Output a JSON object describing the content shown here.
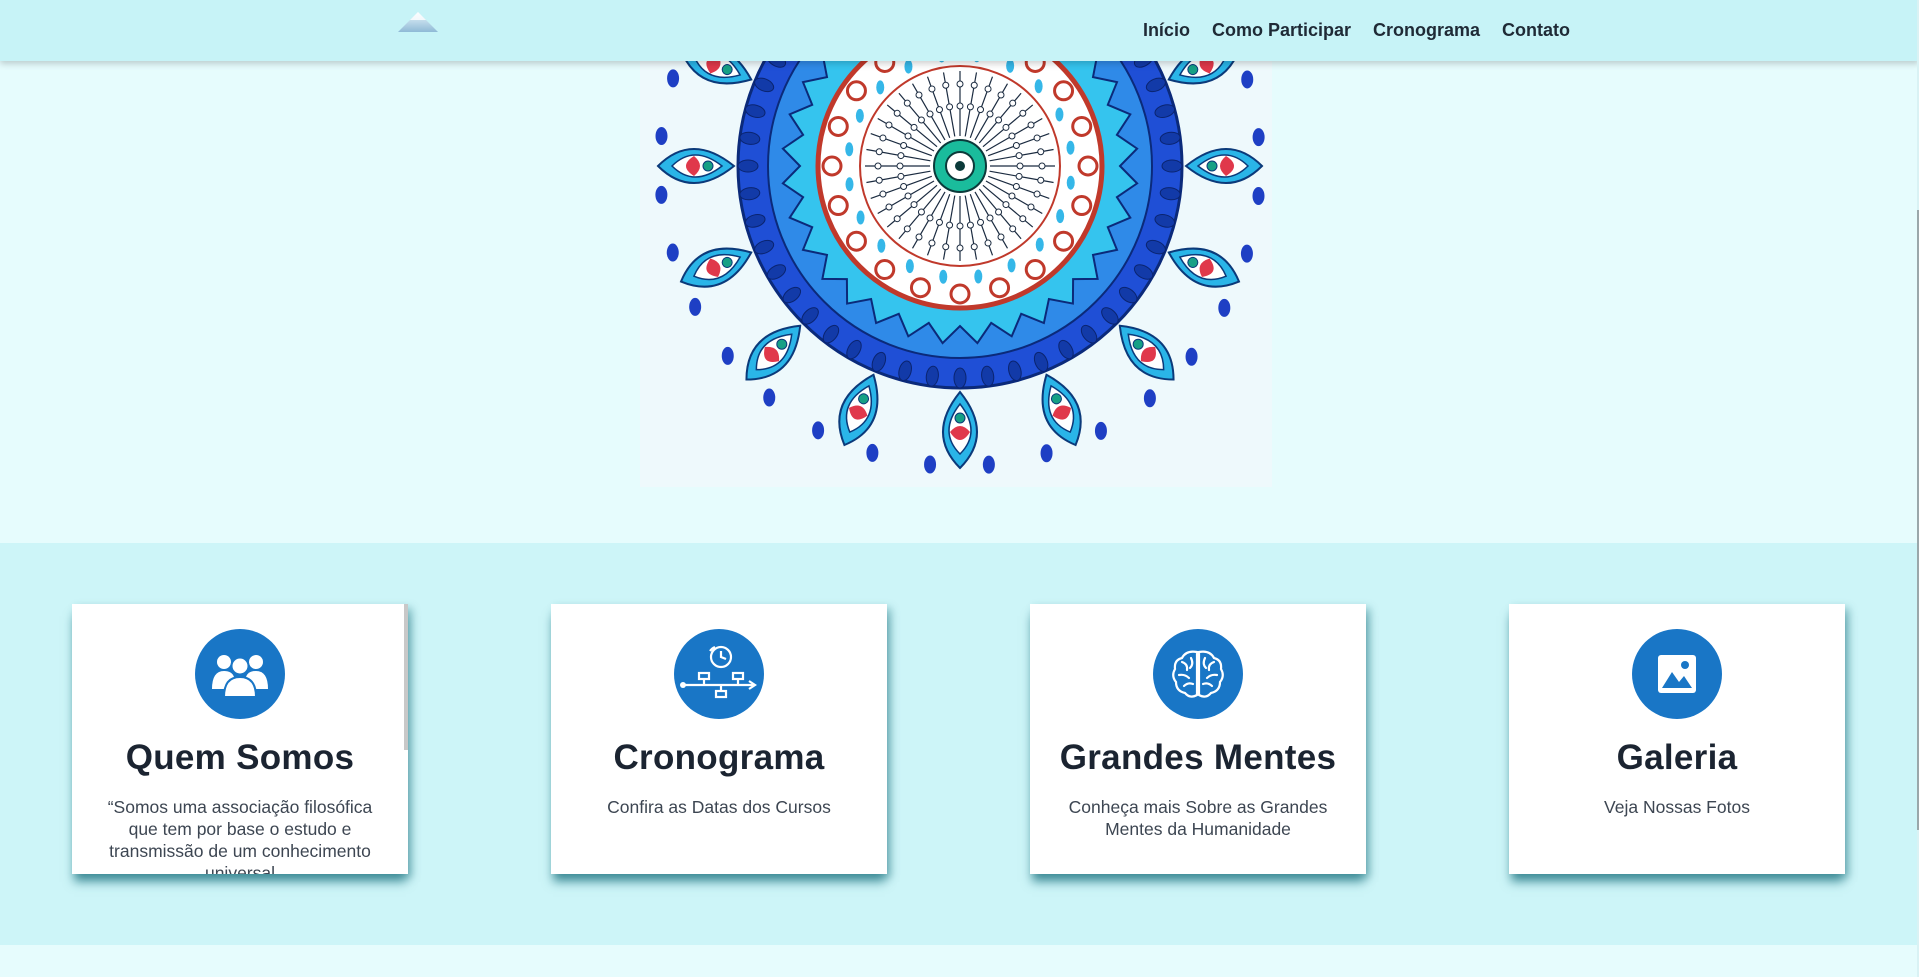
{
  "nav": {
    "logo_icon": "mountain-logo-icon",
    "links": [
      "Início",
      "Como Participar",
      "Cronograma",
      "Contato"
    ]
  },
  "hero": {
    "image": "mandala-image"
  },
  "cards": [
    {
      "icon": "people-group-icon",
      "title": "Quem Somos",
      "text": "“Somos uma associação filosófica que tem por base o estudo e transmissão de um conhecimento universal"
    },
    {
      "icon": "timeline-clock-icon",
      "title": "Cronograma",
      "text": "Confira as Datas dos Cursos"
    },
    {
      "icon": "brain-icon",
      "title": "Grandes Mentes",
      "text": "Conheça mais Sobre as Grandes Mentes da Humanidade"
    },
    {
      "icon": "image-gallery-icon",
      "title": "Galeria",
      "text": "Veja Nossas Fotos"
    }
  ],
  "colors": {
    "navbar": "#c7f3f7",
    "hero_bg": "#e6fcfd",
    "features_bg": "#cdf5f8",
    "icon_blue": "#1976c6"
  }
}
